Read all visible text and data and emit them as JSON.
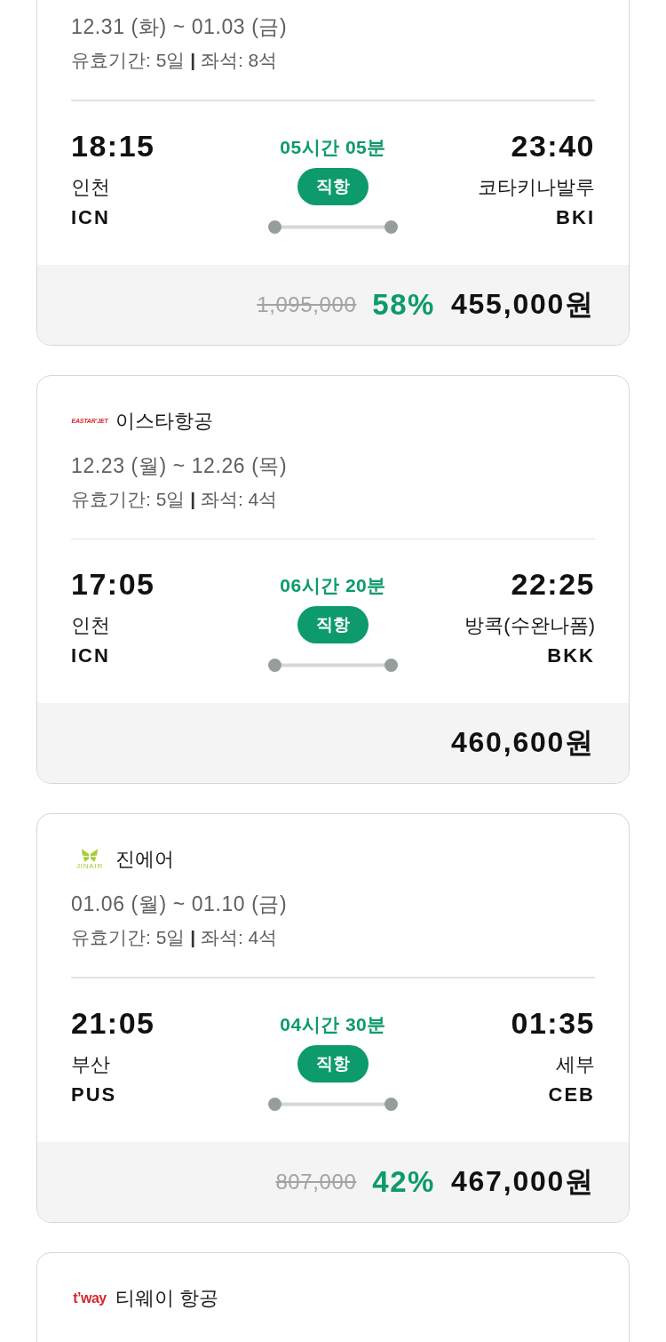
{
  "flights": [
    {
      "date_range": "12.31 (화) ~ 01.03 (금)",
      "details": "유효기간: 5일 **|** 좌석: 8석",
      "departure": {
        "time": "18:15",
        "city": "인천",
        "code": "ICN"
      },
      "duration": "05시간 05분",
      "route_type": "직항",
      "arrival": {
        "time": "23:40",
        "city": "코타키나발루",
        "code": "BKI"
      },
      "original_price": "1,095,000",
      "discount": "58%",
      "price": "455,000원"
    },
    {
      "airline": {
        "name": "이스타항공",
        "logo": {
          "kind": "small-wordmark",
          "text": "EASTAR’JET",
          "color": "#d8262d"
        }
      },
      "date_range": "12.23 (월) ~ 12.26 (목)",
      "details": "유효기간: 5일 **|** 좌석: 4석",
      "departure": {
        "time": "17:05",
        "city": "인천",
        "code": "ICN"
      },
      "duration": "06시간 20분",
      "route_type": "직항",
      "arrival": {
        "time": "22:25",
        "city": "방콕(수완나폼)",
        "code": "BKK"
      },
      "price": "460,600원"
    },
    {
      "airline": {
        "name": "진에어",
        "logo": {
          "kind": "butterfly",
          "text": "JINAIR",
          "color": "#a6cc38"
        }
      },
      "date_range": "01.06 (월) ~ 01.10 (금)",
      "details": "유효기간: 5일 **|** 좌석: 4석",
      "departure": {
        "time": "21:05",
        "city": "부산",
        "code": "PUS"
      },
      "duration": "04시간 30분",
      "route_type": "직항",
      "arrival": {
        "time": "01:35",
        "city": "세부",
        "code": "CEB"
      },
      "original_price": "807,000",
      "discount": "42%",
      "price": "467,000원"
    },
    {
      "airline": {
        "name": "티웨이 항공",
        "logo": {
          "kind": "wordmark",
          "text": "t’way",
          "color": "#d4262c"
        }
      }
    }
  ]
}
